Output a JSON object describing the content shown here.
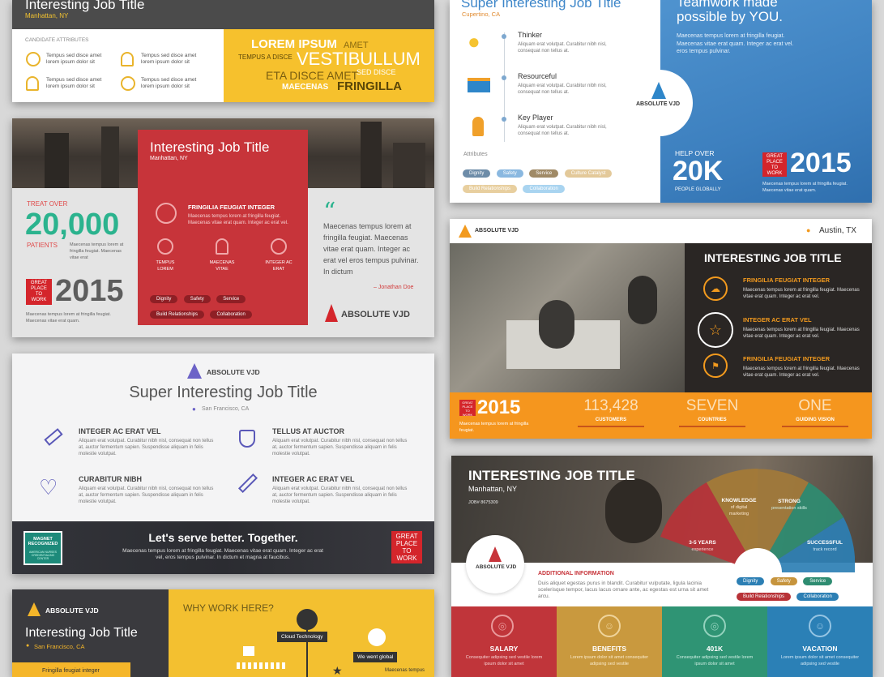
{
  "card1": {
    "title": "Interesting Job Title",
    "location": "Manhattan, NY",
    "attrs_heading": "CANDIDATE ATTRIBUTES",
    "attr_text": "Tempus sed disce amet lorem ipsum dolor sit",
    "wordcloud": {
      "w1": "LOREM IPSUM",
      "w2": "AMET",
      "w3": "TEMPUS A DISCE",
      "w4": "VESTIBULLUM",
      "w5": "ETA DISCE AMET",
      "w6": "SED DISCE",
      "w7": "MAECENAS",
      "w8": "FRINGILLA"
    }
  },
  "card2": {
    "title": "Interesting Job Title",
    "location": "Manhattan, NY",
    "treat": "TREAT OVER",
    "big": "20,000",
    "patients": "PATIENTS",
    "patients_sub": "Maecenas tempus lorem at fringilla feugiat. Maecenas vitae erat",
    "gp": "GREAT PLACE TO WORK",
    "year": "2015",
    "year_sub": "Maecenas tempus lorem at fringilla feugiat. Maecenas vitae erat quam.",
    "red_heading": "FRINGILIA FEUGIAT INTEGER",
    "red_text": "Maecenas tempus lorem at fringilla feugiat. Maecenas vitae erat quam. Integer ac erat vel.",
    "icons": [
      "TEMPUS LOREM",
      "MAECENAS VITAE",
      "INTEGER AC ERAT"
    ],
    "chips": [
      "Dignity",
      "Safety",
      "Service",
      "Build Relationships",
      "Collaboration"
    ],
    "quote": "Maecenas tempus lorem at fringilla feugiat. Maecenas vitae erat quam. Integer ac erat vel eros tempus pulvinar. In dictum",
    "author": "– Jonathan Doe",
    "logo": "ABSOLUTE VJD"
  },
  "card3": {
    "logo": "ABSOLUTE VJD",
    "title": "Super Interesting Job Title",
    "location": "San Francisco, CA",
    "features": [
      {
        "h": "INTEGER AC ERAT VEL",
        "t": "Aliquam erat volutpat. Curabitur nibh nisl, consequat non tellus at, auctor fermentum sapien. Suspendisse aliquam in felis molestie volutpat."
      },
      {
        "h": "TELLUS AT AUCTOR",
        "t": "Aliquam erat volutpat. Curabitur nibh nisl, consequat non tellus at, auctor fermentum sapien. Suspendisse aliquam in felis molestie volutpat."
      },
      {
        "h": "CURABITUR NIBH",
        "t": "Aliquam erat volutpat. Curabitur nibh nisl, consequat non tellus at, auctor fermentum sapien. Suspendisse aliquam in felis molestie volutpat."
      },
      {
        "h": "INTEGER AC ERAT VEL",
        "t": "Aliquam erat volutpat. Curabitur nibh nisl, consequat non tellus at, auctor fermentum sapien. Suspendisse aliquam in felis molestie volutpat."
      }
    ],
    "magnet": "MAGNET RECOGNIZED",
    "magnet_sub": "AMERICAN NURSES CREDENTIALING CENTER",
    "banner_title": "Let's serve better. Together.",
    "banner_text": "Maecenas tempus lorem at fringilla feugiat. Maecenas vitae erat quam. Integer ac erat vel, eros tempus pulvinar. In dictum et magna at faucibus.",
    "gp": "GREAT PLACE TO WORK"
  },
  "card4": {
    "logo": "ABSOLUTE VJD",
    "title": "Interesting Job Title",
    "location": "San Francisco, CA",
    "item": "Fringilla feugiat integer",
    "why": "WHY WORK HERE?",
    "tag1": "Cloud Technology",
    "tag2": "We went global",
    "tag3": "Maecenas tempus"
  },
  "card5": {
    "title": "Super Interesting Job Title",
    "location": "Cupertino, CA",
    "traits": [
      {
        "h": "Thinker",
        "t": "Aliquam erat volutpat. Curabitur nibh nisl, consequat non tellus at."
      },
      {
        "h": "Resourceful",
        "t": "Aliquam erat volutpat. Curabitur nibh nisl, consequat non tellus at."
      },
      {
        "h": "Key Player",
        "t": "Aliquam erat volutpat. Curabitur nibh nisl, consequat non tellus at."
      }
    ],
    "attrs_label": "Attributes",
    "chips": [
      "Dignity",
      "Safety",
      "Service",
      "Culture Catalyst",
      "Build Relationships",
      "Collaboration"
    ],
    "logo": "ABSOLUTE VJD",
    "headline1": "Teamwork made",
    "headline2": "possible by YOU.",
    "blue_text": "Maecenas tempus lorem at fringilla feugiat. Maecenas vitae erat quam. Integer ac erat vel. eros tempus pulvinar.",
    "help": "HELP OVER",
    "big": "20K",
    "people": "PEOPLE GLOBALLY",
    "gp": "GREAT PLACE TO WORK",
    "year": "2015",
    "year_sub": "Maecenas tempus lorem at fringilla feugiat. Maecenas vitae erat quam."
  },
  "card6": {
    "logo": "ABSOLUTE VJD",
    "location": "Austin, TX",
    "title": "INTERESTING JOB TITLE",
    "items": [
      {
        "h": "FRINGILIA FEUGIAT INTEGER",
        "t": "Maecenas tempus lorem at fringilla feugiat. Maecenas vitae erat quam. Integer ac erat vel."
      },
      {
        "h": "INTEGER AC ERAT VEL",
        "t": "Maecenas tempus lorem at fringilla feugiat. Maecenas vitae erat quam. Integer ac erat vel."
      },
      {
        "h": "FRINGILIA FEUGIAT INTEGER",
        "t": "Maecenas tempus lorem at fringilla feugiat. Maecenas vitae erat quam. Integer ac erat vel."
      }
    ],
    "gp": "GREAT PLACE TO WORK",
    "year": "2015",
    "year_sub": "Maecenas tempus lorem at fringilla feugiat.",
    "stats": [
      {
        "v": "113,428",
        "l": "CUSTOMERS"
      },
      {
        "v": "SEVEN",
        "l": "COUNTRIES"
      },
      {
        "v": "ONE",
        "l": "GUIDING VISION"
      }
    ]
  },
  "card7": {
    "title": "INTERESTING JOB TITLE",
    "location": "Manhattan, NY",
    "job": "JOB# 8675309",
    "logo": "ABSOLUTE VJD",
    "wheel": [
      {
        "h": "KNOWLEDGE",
        "t": "of digital marketing"
      },
      {
        "h": "STRONG",
        "t": "presentation skills"
      },
      {
        "h": "3-5 YEARS",
        "t": "experience"
      },
      {
        "h": "SUCCESSFUL",
        "t": "track record"
      }
    ],
    "add_h": "ADDITIONAL INFORMATION",
    "add_t": "Duis aliquet egestas purus in blandit. Curabitur vulputate, ligula lacinia scelerisque tempor, lacus lacus ornare ante, ac egestas est urna sit amet arcu.",
    "chips": [
      "Dignity",
      "Safety",
      "Service",
      "Build Relationships",
      "Collaboration"
    ],
    "tiles": [
      {
        "h": "SALARY",
        "t": "Consequiter adipsing sed vestile lorem ipsum dolor sit amet"
      },
      {
        "h": "BENEFITS",
        "t": "Lorem ipsum dolor sit amet consequiter adipsing sed vestile"
      },
      {
        "h": "401K",
        "t": "Consequiter adipsing sed vestile lorem ipsum dolor sit amet"
      },
      {
        "h": "VACATION",
        "t": "Lorem ipsum dolor sit amet consequiter adipsing sed vestile"
      }
    ]
  }
}
